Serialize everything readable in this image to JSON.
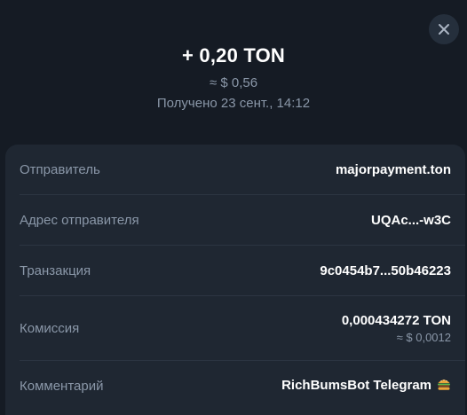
{
  "header": {
    "amount": "+ 0,20 TON",
    "fiat": "≈ $ 0,56",
    "received": "Получено 23 сент., 14:12"
  },
  "close": {
    "icon": "close-icon"
  },
  "details": {
    "sender": {
      "label": "Отправитель",
      "value": "majorpayment.ton"
    },
    "sender_address": {
      "label": "Адрес отправителя",
      "value": "UQAc...-w3C"
    },
    "transaction": {
      "label": "Транзакция",
      "value": "9c0454b7...50b46223"
    },
    "fee": {
      "label": "Комиссия",
      "value": "0,000434272 TON",
      "fiat": "≈ $ 0,0012"
    },
    "comment": {
      "label": "Комментарий",
      "value": "RichBumsBot Telegram",
      "icon": "burger-icon"
    }
  },
  "colors": {
    "background": "#151b24",
    "card": "#1f2732",
    "muted": "#8a97a8",
    "text": "#ffffff"
  }
}
